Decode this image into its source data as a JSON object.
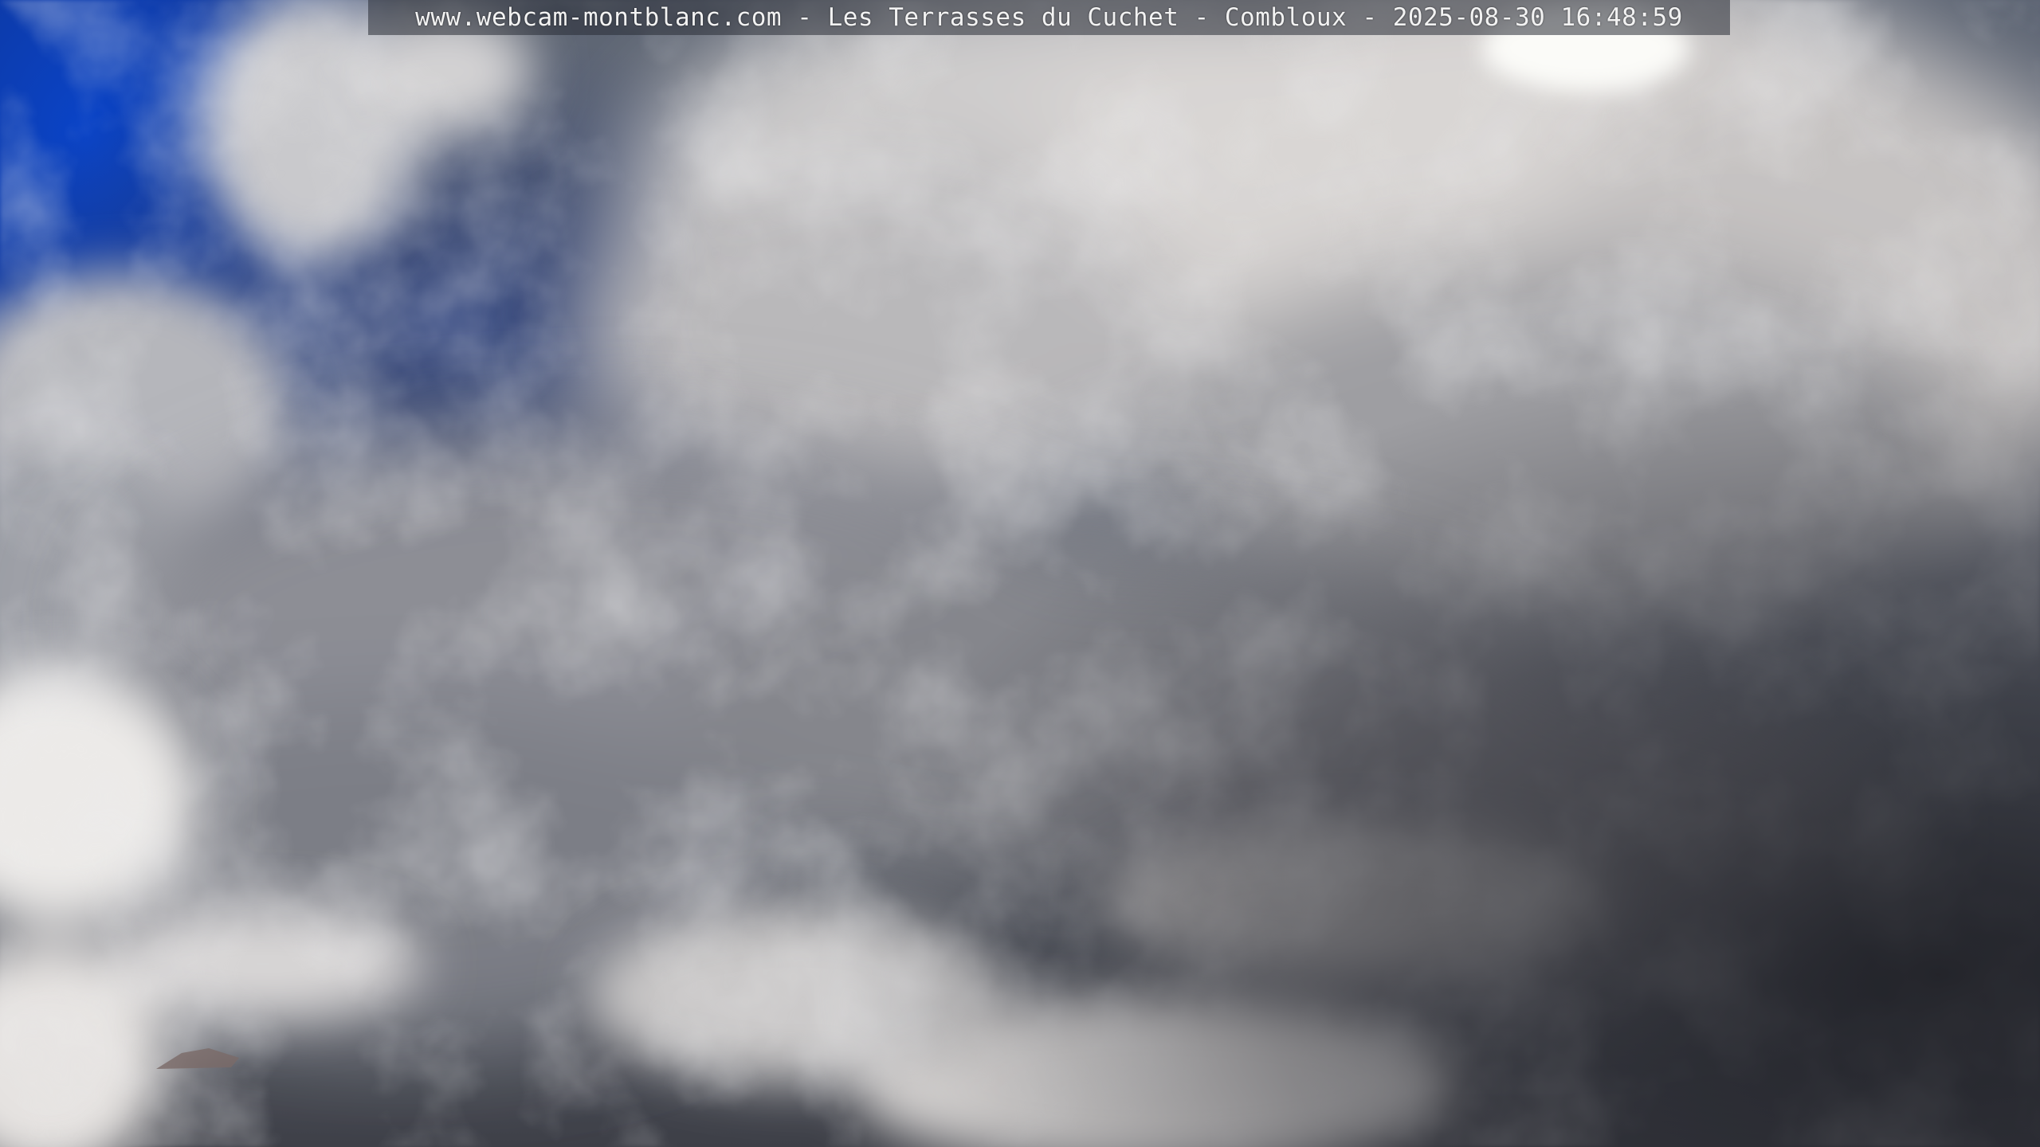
{
  "overlay": {
    "site": "www.webcam-montblanc.com",
    "location": "Les Terrasses du Cuchet",
    "town": "Combloux",
    "date": "2025-08-30",
    "time": "16:48:59",
    "separator": " - "
  },
  "scene": {
    "subject": "cloudy sky",
    "colors": {
      "sky_blue": "#0a44c8",
      "cloud_light": "#e9e6e4",
      "cloud_mid": "#9a9ba1",
      "cloud_dark": "#3e4048",
      "sun_glow": "#fbfbf8"
    }
  }
}
